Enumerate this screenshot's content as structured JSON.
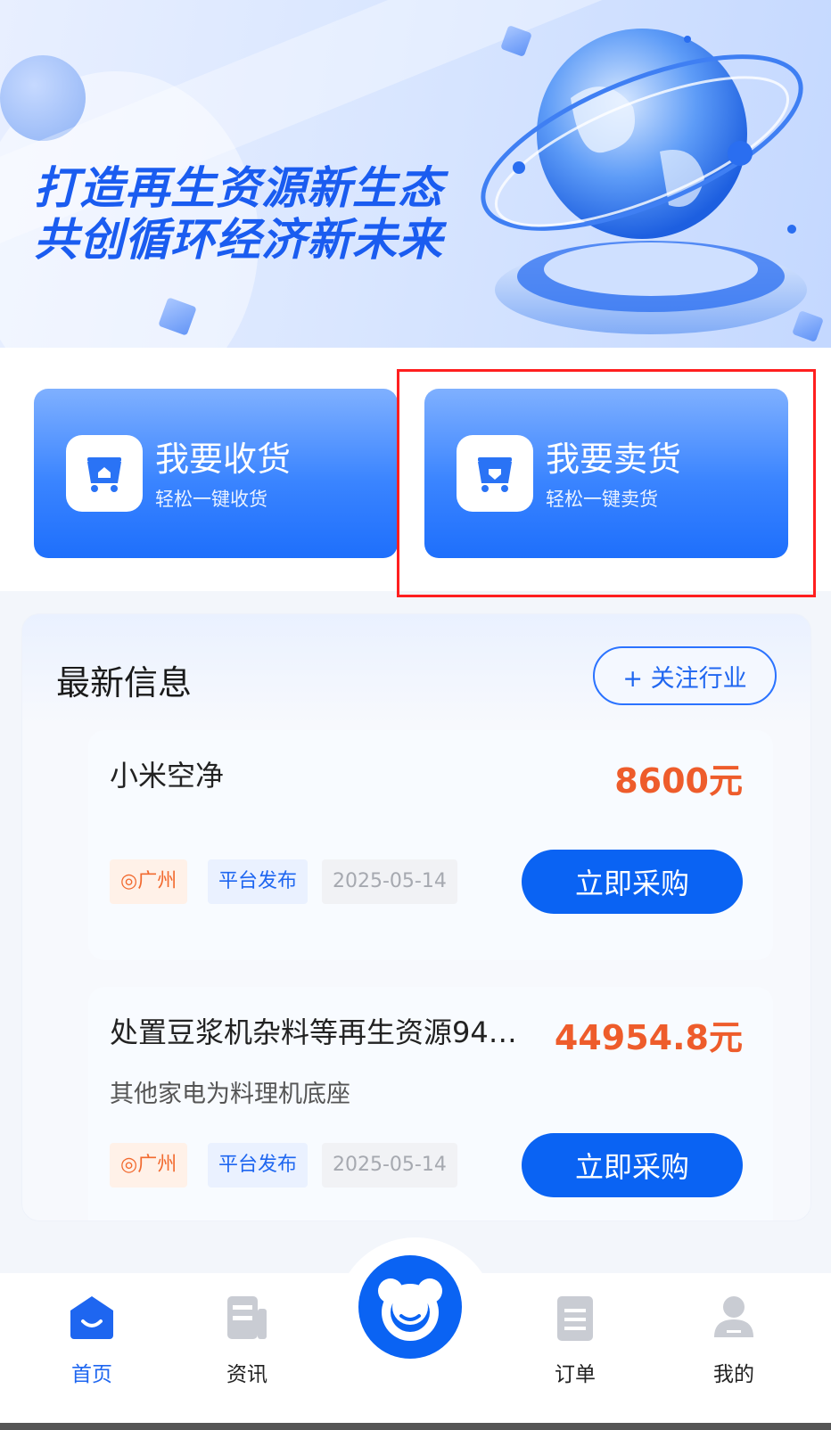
{
  "banner": {
    "headline_line1": "打造再生资源新生态",
    "headline_line2": "共创循环经济新未来"
  },
  "actions": {
    "receive": {
      "title": "我要收货",
      "subtitle": "轻松一键收货"
    },
    "sell": {
      "title": "我要卖货",
      "subtitle": "轻松一键卖货"
    }
  },
  "latest": {
    "title": "最新信息",
    "follow_label": "+ 关注行业",
    "items": [
      {
        "name": "小米空净",
        "price": "8600元",
        "desc": "",
        "location": "广州",
        "source": "平台发布",
        "date": "2025-05-14",
        "buy_label": "立即采购"
      },
      {
        "name": "处置豆浆机杂料等再生资源94…",
        "price": "44954.8元",
        "desc": "其他家电为料理机底座",
        "location": "广州",
        "source": "平台发布",
        "date": "2025-05-14",
        "buy_label": "立即采购"
      }
    ]
  },
  "tabbar": {
    "items": [
      {
        "label": "首页",
        "icon": "home-icon",
        "active": true
      },
      {
        "label": "资讯",
        "icon": "news-icon",
        "active": false
      },
      {
        "label": "",
        "icon": "bear-mascot-icon",
        "active": false
      },
      {
        "label": "订单",
        "icon": "order-icon",
        "active": false
      },
      {
        "label": "我的",
        "icon": "profile-icon",
        "active": false
      }
    ]
  },
  "colors": {
    "primary": "#0a63f3",
    "price": "#ee5c2b",
    "annotation": "#ff1f1f"
  }
}
